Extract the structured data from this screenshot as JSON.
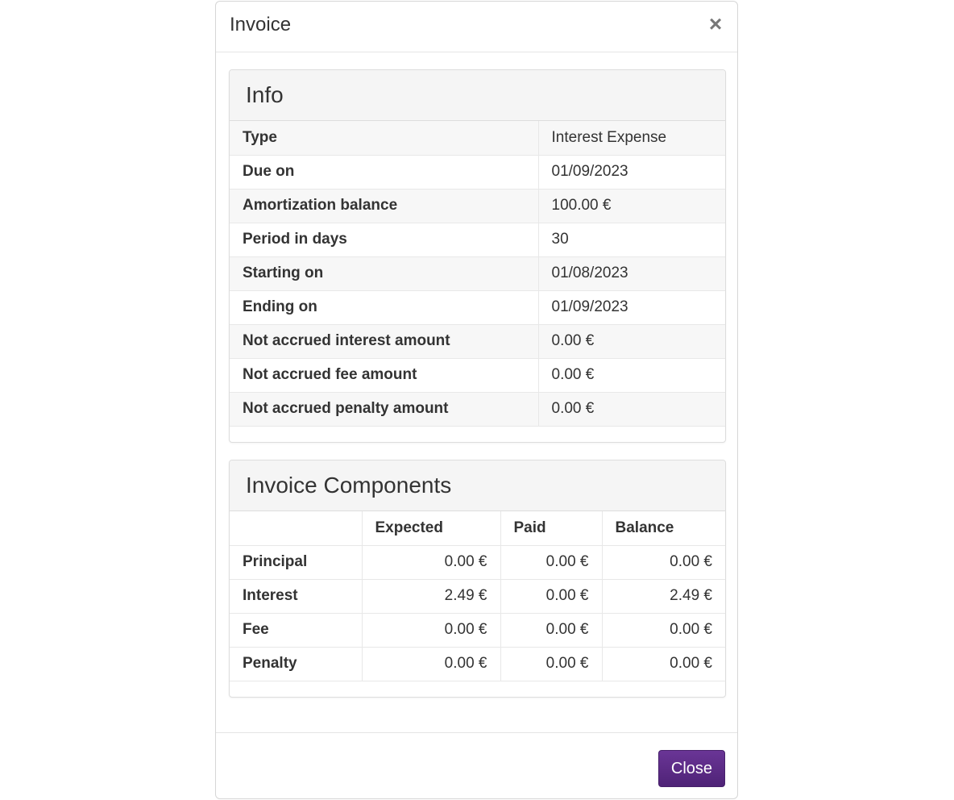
{
  "modal": {
    "title": "Invoice",
    "close_icon": "×"
  },
  "info": {
    "heading": "Info",
    "rows": [
      {
        "label": "Type",
        "value": "Interest Expense"
      },
      {
        "label": "Due on",
        "value": "01/09/2023"
      },
      {
        "label": "Amortization balance",
        "value": "100.00 €"
      },
      {
        "label": "Period in days",
        "value": "30"
      },
      {
        "label": "Starting on",
        "value": "01/08/2023"
      },
      {
        "label": "Ending on",
        "value": "01/09/2023"
      },
      {
        "label": "Not accrued interest amount",
        "value": "0.00 €"
      },
      {
        "label": "Not accrued fee amount",
        "value": "0.00 €"
      },
      {
        "label": "Not accrued penalty amount",
        "value": "0.00 €"
      }
    ]
  },
  "components": {
    "heading": "Invoice Components",
    "columns": [
      "",
      "Expected",
      "Paid",
      "Balance"
    ],
    "rows": [
      {
        "name": "Principal",
        "expected": "0.00 €",
        "paid": "0.00 €",
        "balance": "0.00 €"
      },
      {
        "name": "Interest",
        "expected": "2.49 €",
        "paid": "0.00 €",
        "balance": "2.49 €"
      },
      {
        "name": "Fee",
        "expected": "0.00 €",
        "paid": "0.00 €",
        "balance": "0.00 €"
      },
      {
        "name": "Penalty",
        "expected": "0.00 €",
        "paid": "0.00 €",
        "balance": "0.00 €"
      }
    ]
  },
  "footer": {
    "close_label": "Close"
  },
  "colors": {
    "primary_button": "#5b2a86",
    "panel_heading_bg": "#f5f5f5"
  }
}
